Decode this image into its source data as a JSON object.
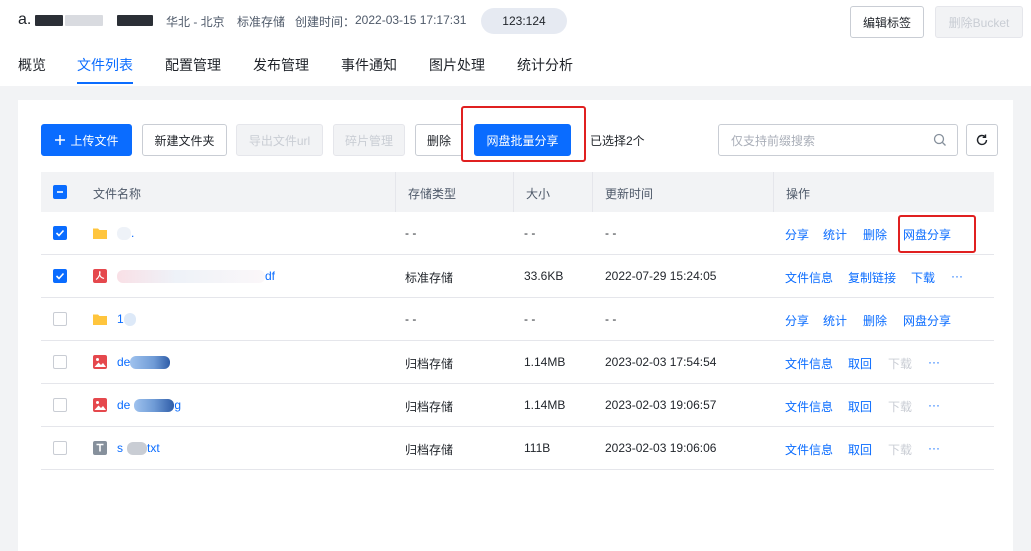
{
  "header": {
    "bucket_prefix": "a.",
    "region": "华北 - 北京",
    "storage_class": "标准存储",
    "created_label": "创建时间：",
    "created_time": "2022-03-15 17:17:31",
    "tag": "123:124",
    "edit_tags_label": "编辑标签",
    "delete_bucket_label": "删除Bucket"
  },
  "tabs": [
    "概览",
    "文件列表",
    "配置管理",
    "发布管理",
    "事件通知",
    "图片处理",
    "统计分析"
  ],
  "active_tab": "文件列表",
  "toolbar": {
    "upload_label": "上传文件",
    "new_folder_label": "新建文件夹",
    "export_url_label": "导出文件url",
    "fragments_label": "碎片管理",
    "delete_label": "删除",
    "batch_share_label": "网盘批量分享",
    "selected_text": "已选择2个",
    "search_placeholder": "仅支持前缀搜索"
  },
  "table": {
    "columns": [
      "文件名称",
      "存储类型",
      "大小",
      "更新时间",
      "操作"
    ],
    "rows": [
      {
        "checked": true,
        "icon": "folder-icon",
        "name": ".",
        "storage": "- -",
        "size": "- -",
        "updated": "- -",
        "actions": [
          {
            "label": "分享",
            "enabled": true
          },
          {
            "label": "统计",
            "enabled": true
          },
          {
            "label": "删除",
            "enabled": true
          },
          {
            "label": "网盘分享",
            "enabled": true
          }
        ]
      },
      {
        "checked": true,
        "icon": "pdf-icon",
        "name": "df",
        "storage": "标准存储",
        "size": "33.6KB",
        "updated": "2022-07-29 15:24:05",
        "actions": [
          {
            "label": "文件信息",
            "enabled": true
          },
          {
            "label": "复制链接",
            "enabled": true
          },
          {
            "label": "下载",
            "enabled": true
          },
          {
            "label": "···",
            "enabled": true
          }
        ]
      },
      {
        "checked": false,
        "icon": "folder-icon",
        "name": "1",
        "storage": "- -",
        "size": "- -",
        "updated": "- -",
        "actions": [
          {
            "label": "分享",
            "enabled": true
          },
          {
            "label": "统计",
            "enabled": true
          },
          {
            "label": "删除",
            "enabled": true
          },
          {
            "label": "网盘分享",
            "enabled": true
          }
        ]
      },
      {
        "checked": false,
        "icon": "image-icon",
        "name": "de",
        "storage": "归档存储",
        "size": "1.14MB",
        "updated": "2023-02-03 17:54:54",
        "actions": [
          {
            "label": "文件信息",
            "enabled": true
          },
          {
            "label": "取回",
            "enabled": true
          },
          {
            "label": "下载",
            "enabled": false
          },
          {
            "label": "···",
            "enabled": true
          }
        ]
      },
      {
        "checked": false,
        "icon": "image-icon",
        "name": "de",
        "name_suffix": "g",
        "storage": "归档存储",
        "size": "1.14MB",
        "updated": "2023-02-03 19:06:57",
        "actions": [
          {
            "label": "文件信息",
            "enabled": true
          },
          {
            "label": "取回",
            "enabled": true
          },
          {
            "label": "下载",
            "enabled": false
          },
          {
            "label": "···",
            "enabled": true
          }
        ]
      },
      {
        "checked": false,
        "icon": "text-file-icon",
        "name": "s",
        "name_suffix": "txt",
        "storage": "归档存储",
        "size": "111B",
        "updated": "2023-02-03 19:06:06",
        "actions": [
          {
            "label": "文件信息",
            "enabled": true
          },
          {
            "label": "取回",
            "enabled": true
          },
          {
            "label": "下载",
            "enabled": false
          },
          {
            "label": "···",
            "enabled": true
          }
        ]
      }
    ]
  },
  "colors": {
    "primary": "#0a6cff",
    "highlight_box": "#e02020",
    "folder": "#ffc53d",
    "pdf": "#e5484d",
    "image": "#e5484d",
    "text_file": "#86909c"
  }
}
